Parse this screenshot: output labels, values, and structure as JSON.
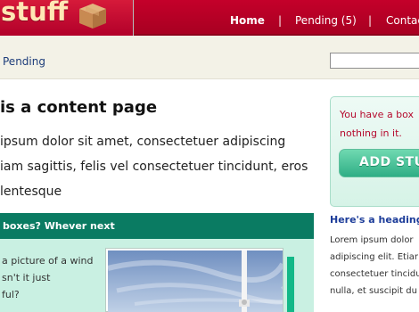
{
  "header": {
    "logo_text": "stuff",
    "logo_icon": "box-icon",
    "nav": {
      "home": "Home",
      "separator": "|",
      "pending": "Pending (5)",
      "contact": "Contac"
    }
  },
  "subbar": {
    "breadcrumb": "Pending",
    "search": {
      "value": "",
      "placeholder": ""
    }
  },
  "content": {
    "title": "is a content page",
    "paragraph_lines": [
      "ipsum dolor sit amet, consectetuer adipiscing",
      "iam sagittis, felis vel consectetuer tincidunt, eros",
      "lentesque"
    ],
    "section_heading": "boxes? Whever next",
    "section_text_lines": [
      "a picture of a wind",
      "sn't it just",
      "ful?"
    ],
    "photo_icon": "wind-turbine-photo"
  },
  "sidebar": {
    "callout_lines": [
      "You have a box",
      "nothing in it."
    ],
    "add_button": "ADD STUF",
    "heading": "Here's a heading",
    "text_lines": [
      "Lorem ipsum dolor",
      "adipiscing elit. Etiar",
      "consectetuer tincidu",
      "nulla, et suscipit du"
    ]
  },
  "colors": {
    "header_red": "#b5002a",
    "logo_text": "#ffe7b4",
    "section_green": "#0a7b62",
    "panel_mint": "#c9f0e2",
    "accent_green": "#12b888",
    "link_blue": "#1d3d9a",
    "callout_red": "#b50a2d"
  }
}
